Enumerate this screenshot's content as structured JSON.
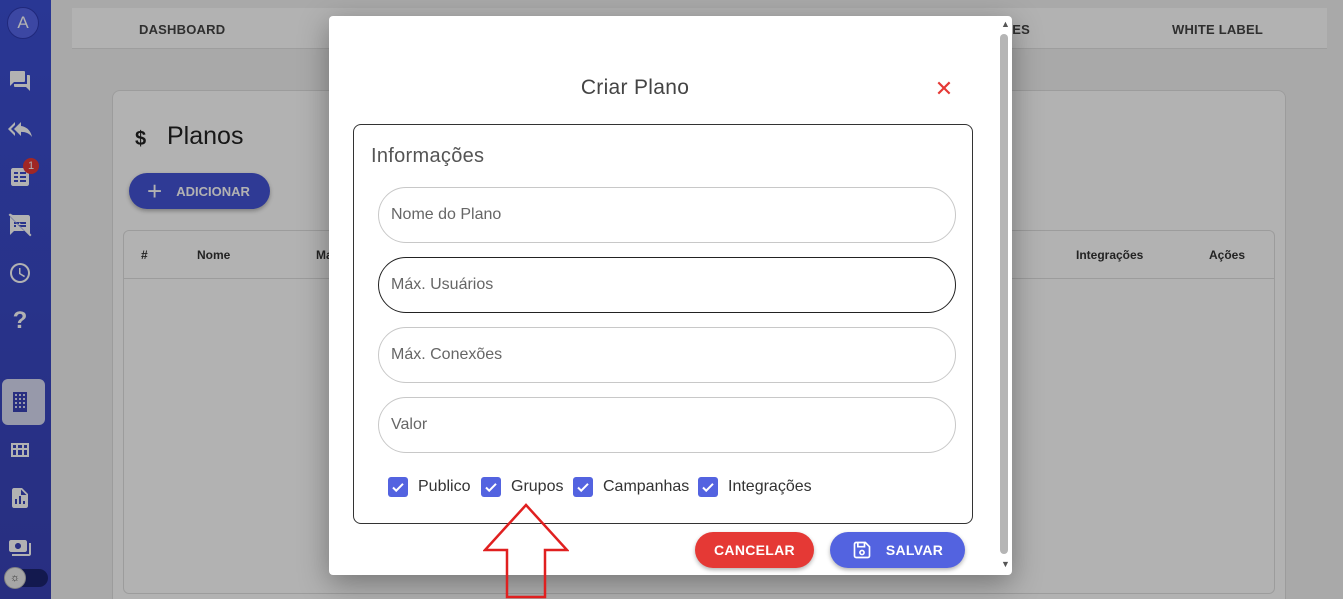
{
  "sidebar": {
    "avatar_letter": "A",
    "badge_count": "1",
    "icons": [
      "chat-icon",
      "reply-all-icon",
      "tasks-icon",
      "speaker-off-icon",
      "clock-icon",
      "help-icon",
      "building-icon",
      "dashboard-grid-icon",
      "report-icon",
      "money-icon"
    ],
    "theme_toggle_icon": "sun-icon"
  },
  "topnav": {
    "items": [
      "DASHBOARD",
      "ÕES",
      "WHITE LABEL"
    ]
  },
  "page": {
    "title": "Planos",
    "title_icon": "$",
    "add_button": "ADICIONAR",
    "table_headers": [
      "#",
      "Nome",
      "Ma",
      "Integrações",
      "Ações"
    ]
  },
  "modal": {
    "title": "Criar Plano",
    "section_title": "Informações",
    "fields": {
      "plan_name": {
        "placeholder": "Nome do Plano",
        "value": ""
      },
      "max_users": {
        "placeholder": "Máx. Usuários",
        "value": ""
      },
      "max_connections": {
        "placeholder": "Máx. Conexões",
        "value": ""
      },
      "price": {
        "placeholder": "Valor",
        "value": ""
      }
    },
    "checkboxes": [
      {
        "label": "Publico",
        "checked": true
      },
      {
        "label": "Grupos",
        "checked": true
      },
      {
        "label": "Campanhas",
        "checked": true
      },
      {
        "label": "Integrações",
        "checked": true
      }
    ],
    "cancel_button": "CANCELAR",
    "save_button": "SALVAR"
  },
  "colors": {
    "sidebar": "#3b4fd4",
    "primary": "#5363e0",
    "danger": "#e53935",
    "arrow_annotation": "#e02020"
  }
}
